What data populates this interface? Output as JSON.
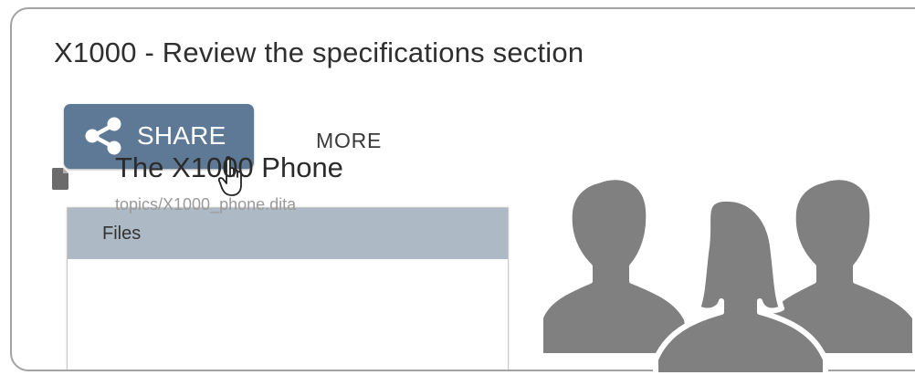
{
  "header": {
    "title": "X1000 - Review the specifications section"
  },
  "actions": {
    "share_label": "SHARE",
    "share_icon": "share-icon",
    "more_label": "MORE",
    "cursor_icon": "hand-pointer-icon"
  },
  "files": {
    "header_label": "Files",
    "items": [
      {
        "title": "The X1000 Phone",
        "path": "topics/X1000_phone.dita",
        "icon": "document-icon"
      }
    ]
  },
  "illustration": {
    "icon": "people-group-icon"
  },
  "colors": {
    "share_bg": "#5e7996",
    "files_header_bg": "#adbac6",
    "silhouette": "#808080",
    "border": "#a3a3a3"
  }
}
